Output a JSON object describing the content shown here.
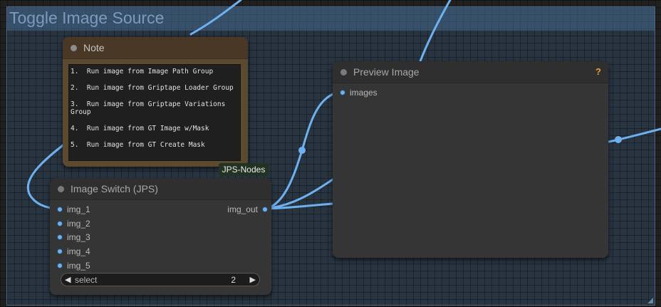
{
  "group": {
    "title": "Toggle Image Source"
  },
  "note": {
    "title": "Note",
    "lines": [
      "1.  Run image from Image Path Group",
      "2.  Run image from Griptape Loader Group",
      "3.  Run image from Griptape Variations Group",
      "4.  Run image from GT Image w/Mask",
      "5.  Run image from GT Create Mask"
    ]
  },
  "badge": {
    "label": "JPS-Nodes"
  },
  "image_switch": {
    "title": "Image Switch (JPS)",
    "inputs": [
      "img_1",
      "img_2",
      "img_3",
      "img_4",
      "img_5"
    ],
    "output": "img_out",
    "widget": {
      "label": "select",
      "value": "2",
      "left_arrow": "◀",
      "right_arrow": "▶"
    }
  },
  "preview": {
    "title": "Preview Image",
    "input": "images",
    "help": "?"
  },
  "colors": {
    "link": "#6fb0ee",
    "group_title": "#7b9bbd",
    "help": "#e6a23c"
  }
}
